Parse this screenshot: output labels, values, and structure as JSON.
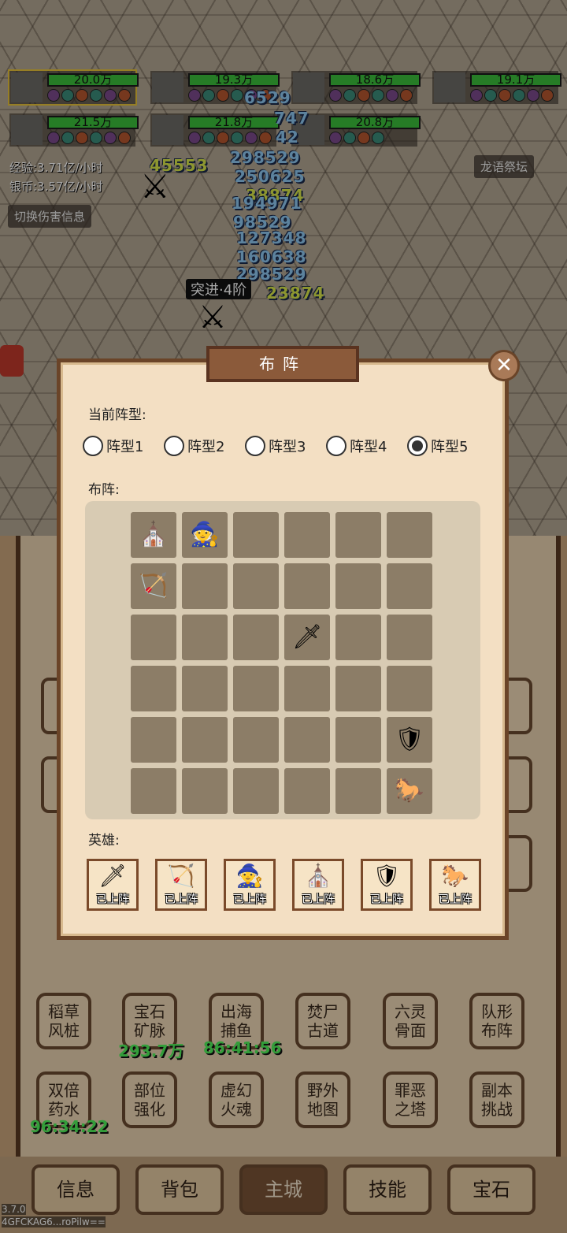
{
  "heroes": [
    {
      "power": "20.0万",
      "selected": true
    },
    {
      "power": "19.3万"
    },
    {
      "power": "18.6万"
    },
    {
      "power": "19.1万"
    },
    {
      "power": "21.5万"
    },
    {
      "power": "21.8万"
    },
    {
      "power": "20.8万"
    }
  ],
  "stats": {
    "exp": "经验:3.71亿/小时",
    "silver": "银币:3.57亿/小时"
  },
  "toggle_damage": "切换伤害信息",
  "dragon_altar": "龙语祭坛",
  "combat": {
    "stage": "突进·4阶",
    "numbers": [
      "6529",
      "747",
      "42",
      "45553",
      "298529",
      "250625",
      "38874",
      "194971",
      "98529",
      "127348",
      "160638",
      "298529",
      "23874"
    ]
  },
  "dialog": {
    "title": "布阵",
    "close_icon": "close-icon",
    "current_formation_label": "当前阵型:",
    "formations": [
      {
        "label": "阵型1",
        "selected": false
      },
      {
        "label": "阵型2",
        "selected": false
      },
      {
        "label": "阵型3",
        "selected": false
      },
      {
        "label": "阵型4",
        "selected": false
      },
      {
        "label": "阵型5",
        "selected": true
      }
    ],
    "layout_label": "布阵:",
    "heroes_label": "英雄:",
    "roster": [
      {
        "unit": "swordswoman",
        "status": "已上阵"
      },
      {
        "unit": "archer",
        "status": "已上阵"
      },
      {
        "unit": "mage",
        "status": "已上阵"
      },
      {
        "unit": "priest",
        "status": "已上阵"
      },
      {
        "unit": "knight",
        "status": "已上阵"
      },
      {
        "unit": "cavalry",
        "status": "已上阵"
      }
    ]
  },
  "features": [
    {
      "label": "稻草\n风桩"
    },
    {
      "label": "宝石\n矿脉",
      "timer": "293.7万"
    },
    {
      "label": "出海\n捕鱼",
      "timer": "86:41:56"
    },
    {
      "label": "焚尸\n古道"
    },
    {
      "label": "六灵\n骨面"
    },
    {
      "label": "队形\n布阵"
    },
    {
      "label": "双倍\n药水",
      "timer": "96:34:22"
    },
    {
      "label": "部位\n强化"
    },
    {
      "label": "虚幻\n火魂"
    },
    {
      "label": "野外\n地图"
    },
    {
      "label": "罪恶\n之塔"
    },
    {
      "label": "副本\n挑战"
    }
  ],
  "nav": [
    {
      "label": "信息"
    },
    {
      "label": "背包"
    },
    {
      "label": "主城",
      "active": true
    },
    {
      "label": "技能"
    },
    {
      "label": "宝石"
    }
  ],
  "footer": {
    "version": "3.7.0",
    "id": "4GFCKAG6...roPilw=="
  }
}
